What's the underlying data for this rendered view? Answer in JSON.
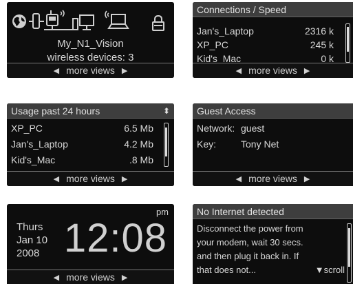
{
  "home": {
    "router_name": "My_N1_Vision",
    "wireless_text": "wireless devices: 3",
    "footer": "more views"
  },
  "connections": {
    "title": "Connections / Speed",
    "rows": [
      {
        "name": "Jan's_Laptop",
        "speed": "2316 k"
      },
      {
        "name": "XP_PC",
        "speed": "245 k"
      },
      {
        "name": "Kid's_Mac",
        "speed": "0 k"
      }
    ],
    "footer": "more views"
  },
  "usage": {
    "title": "Usage past 24 hours",
    "rows": [
      {
        "name": "XP_PC",
        "amount": "6.5 Mb"
      },
      {
        "name": "Jan's_Laptop",
        "amount": "4.2 Mb"
      },
      {
        "name": "Kid's_Mac",
        "amount": ".8 Mb"
      }
    ],
    "footer": "more views"
  },
  "guest": {
    "title": "Guest Access",
    "network_label": "Network:",
    "network_value": "guest",
    "key_label": "Key:",
    "key_value": "Tony Net",
    "footer": "more views"
  },
  "clock": {
    "day": "Thurs",
    "date": "Jan 10",
    "year": "2008",
    "time": "12:08",
    "ampm": "pm",
    "footer": "more views"
  },
  "alert": {
    "title": "No Internet detected",
    "lines": [
      "Disconnect the power from",
      "your modem, wait 30 secs.",
      "and then plug it back in. If",
      "that does not..."
    ],
    "scroll_label": "▼scroll"
  },
  "icons": {
    "globe": "globe-icon",
    "modem": "modem-icon",
    "router": "wireless-router-icon",
    "desktop": "desktop-computer-icon",
    "laptop": "wireless-laptop-icon",
    "lock": "lock-icon",
    "left": "◀",
    "right": "▶",
    "sort": "⬍"
  },
  "colors": {
    "screen_bg": "#0d0d0d",
    "title_bg": "#3e3e3e",
    "text": "#d8d8d8"
  }
}
